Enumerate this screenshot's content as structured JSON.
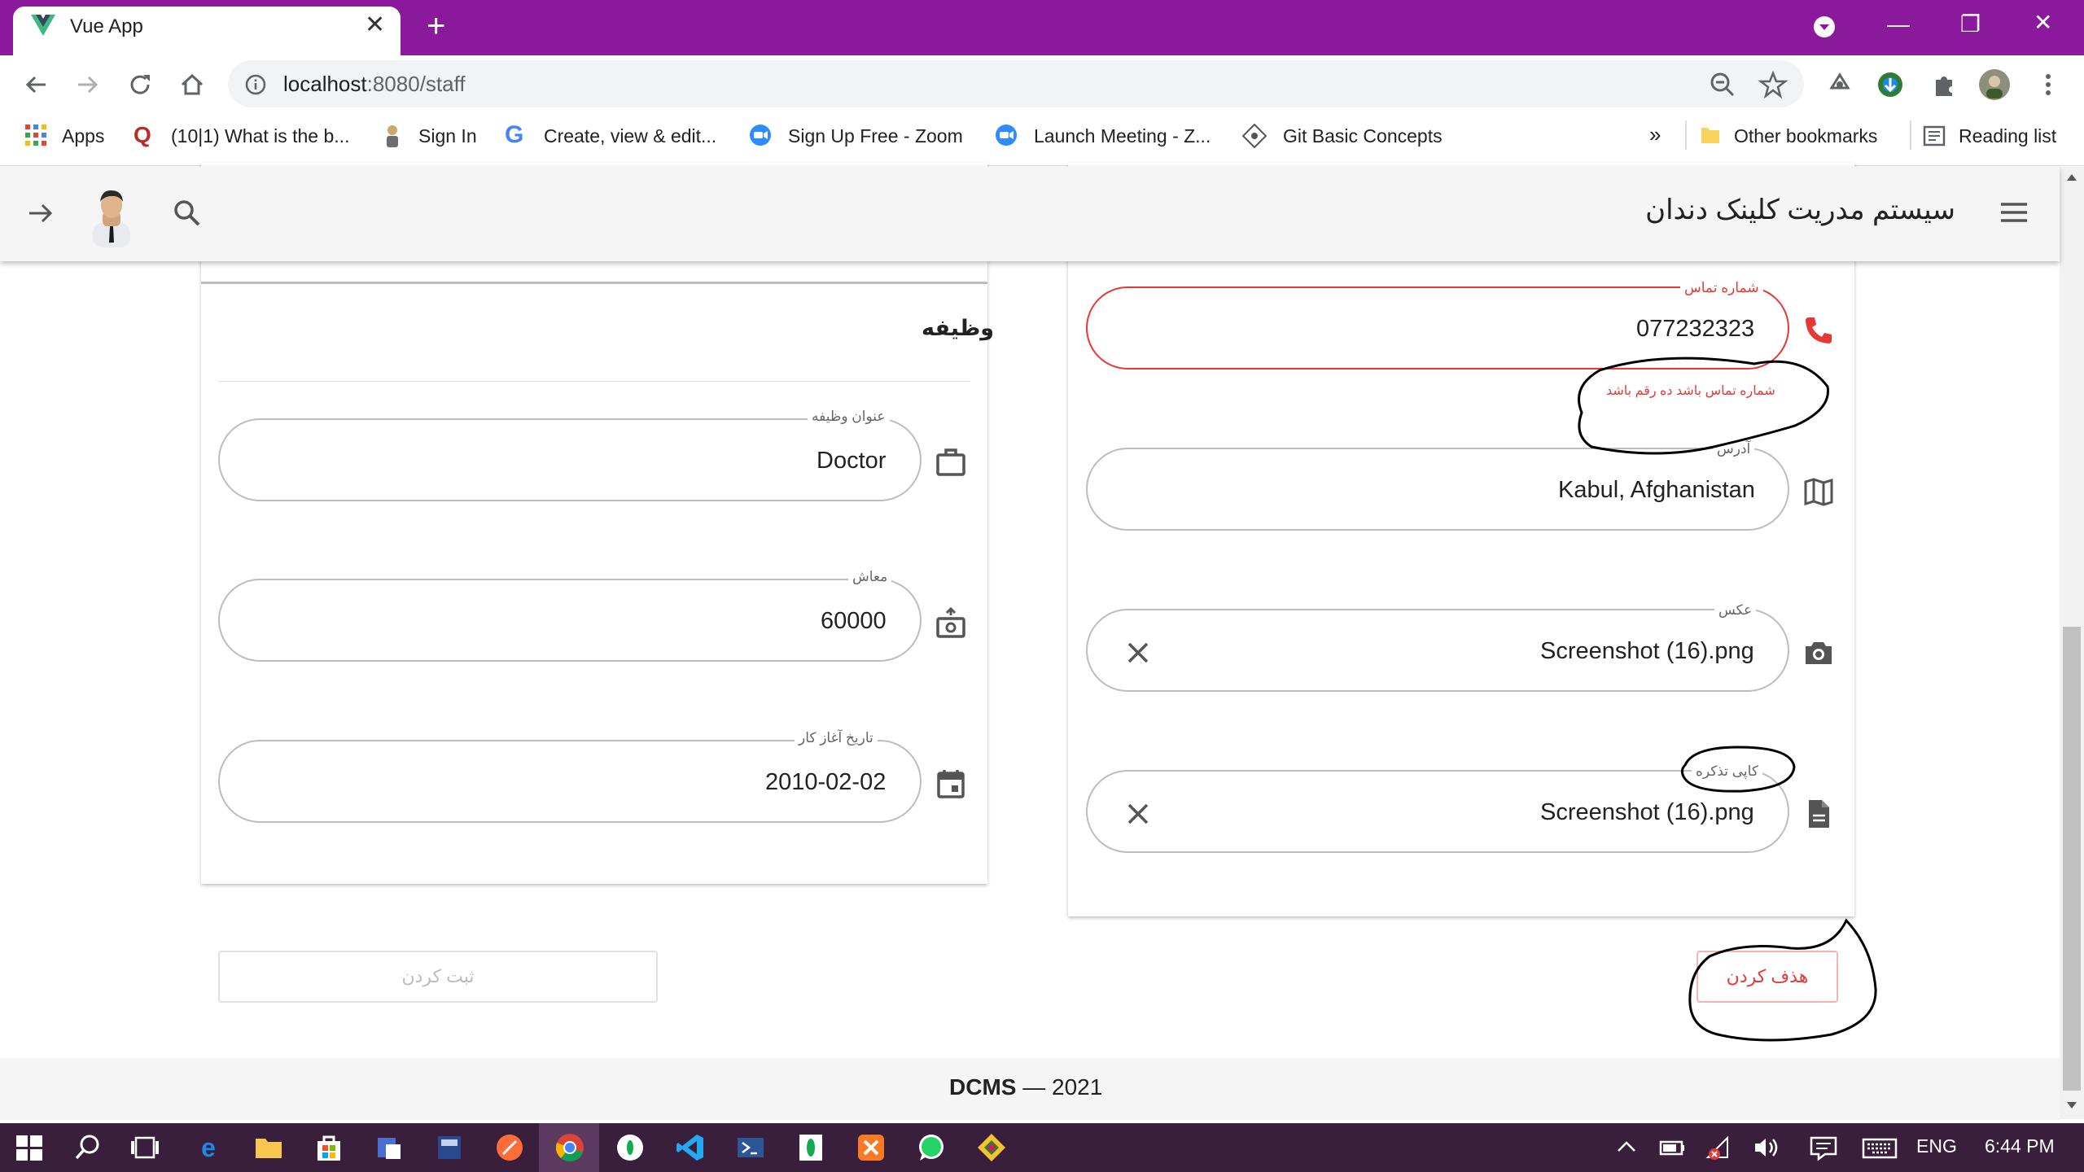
{
  "browser": {
    "tab_title": "Vue App",
    "tab_close": "✕",
    "new_tab": "+",
    "url_host": "localhost",
    "url_path": ":8080/staff",
    "window_controls": {
      "minimize": "—",
      "restore": "❐",
      "close": "✕"
    },
    "bookmarks": [
      {
        "label": "Apps",
        "icon": "apps-grid-icon"
      },
      {
        "label": "(10|1) What is the b...",
        "icon": "quora-icon"
      },
      {
        "label": "Sign In",
        "icon": "sign-in-icon"
      },
      {
        "label": "Create, view & edit...",
        "icon": "google-icon"
      },
      {
        "label": "Sign Up Free - Zoom",
        "icon": "zoom-icon"
      },
      {
        "label": "Launch Meeting - Z...",
        "icon": "zoom-icon"
      },
      {
        "label": "Git Basic Concepts",
        "icon": "git-icon"
      }
    ],
    "bookmarks_overflow": "»",
    "other_bookmarks": "Other bookmarks",
    "reading_list": "Reading list"
  },
  "app": {
    "title": "سیستم مدریت کلینک دندان"
  },
  "job_card": {
    "heading": "وظیفه",
    "fields": [
      {
        "label": "عنوان وظیفه",
        "value": "Doctor",
        "icon": "briefcase-icon"
      },
      {
        "label": "معاش",
        "value": "60000",
        "icon": "cash-icon"
      },
      {
        "label": "تاریخ آغاز کار",
        "value": "2010-02-02",
        "icon": "calendar-icon"
      }
    ]
  },
  "contact_card": {
    "phone": {
      "label": "شماره تماس",
      "value": "077232323",
      "error": "شماره تماس باشد ده رقم باشد",
      "icon": "phone-icon"
    },
    "address": {
      "label": "آدرس",
      "value": "Kabul, Afghanistan",
      "icon": "map-icon"
    },
    "photo": {
      "label": "عکس",
      "value": "Screenshot (16).png",
      "icon": "camera-icon"
    },
    "tazkira": {
      "label": "کاپی تذکره",
      "value": "Screenshot (16).png",
      "icon": "file-icon"
    }
  },
  "actions": {
    "submit": "ثبت کردن",
    "delete": "هذف کردن"
  },
  "footer": {
    "brand": "DCMS",
    "sep": "—",
    "year": "2021"
  },
  "taskbar": {
    "lang": "ENG",
    "time": "6:44 PM"
  },
  "colors": {
    "tabstrip": "#8a1a9b",
    "error": "#e53935",
    "taskbar": "#3a1f3d"
  }
}
